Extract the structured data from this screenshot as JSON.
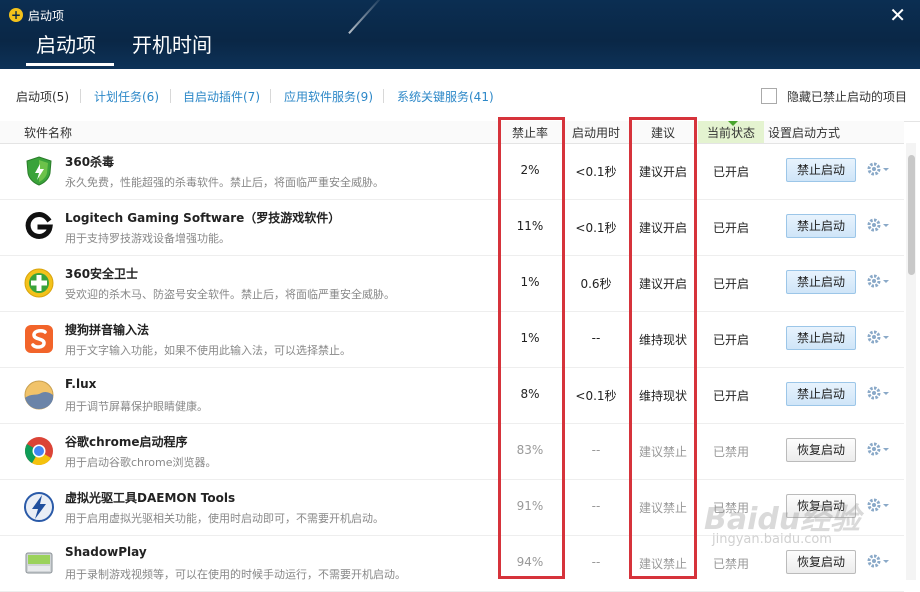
{
  "window": {
    "title": "启动项",
    "close": "✕"
  },
  "header_tabs": [
    {
      "label": "启动项"
    },
    {
      "label": "开机时间"
    }
  ],
  "subtabs": [
    {
      "label": "启动项(5)"
    },
    {
      "label": "计划任务(6)"
    },
    {
      "label": "自启动插件(7)"
    },
    {
      "label": "应用软件服务(9)"
    },
    {
      "label": "系统关键服务(41)"
    }
  ],
  "hide_disabled_label": "隐藏已禁止启动的项目",
  "columns": {
    "name": "软件名称",
    "rate": "禁止率",
    "time": "启动用时",
    "advice": "建议",
    "status": "当前状态",
    "method": "设置启动方式"
  },
  "rows": [
    {
      "icon": "shield-icon",
      "name": "360杀毒",
      "desc": "永久免费，性能超强的杀毒软件。禁止后，将面临严重安全威胁。",
      "rate": "2%",
      "time": "<0.1秒",
      "advice": "建议开启",
      "status": "已开启",
      "button": "禁止启动",
      "enabled": true
    },
    {
      "icon": "logitech-icon",
      "name": "Logitech Gaming Software（罗技游戏软件）",
      "desc": "用于支持罗技游戏设备增强功能。",
      "rate": "11%",
      "time": "<0.1秒",
      "advice": "建议开启",
      "status": "已开启",
      "button": "禁止启动",
      "enabled": true
    },
    {
      "icon": "guard-icon",
      "name": "360安全卫士",
      "desc": "受欢迎的杀木马、防盗号安全软件。禁止后，将面临严重安全威胁。",
      "rate": "1%",
      "time": "0.6秒",
      "advice": "建议开启",
      "status": "已开启",
      "button": "禁止启动",
      "enabled": true
    },
    {
      "icon": "sogou-icon",
      "name": "搜狗拼音输入法",
      "desc": "用于文字输入功能，如果不使用此输入法，可以选择禁止。",
      "rate": "1%",
      "time": "--",
      "advice": "维持现状",
      "status": "已开启",
      "button": "禁止启动",
      "enabled": true
    },
    {
      "icon": "flux-icon",
      "name": "F.lux",
      "desc": "用于调节屏幕保护眼睛健康。",
      "rate": "8%",
      "time": "<0.1秒",
      "advice": "维持现状",
      "status": "已开启",
      "button": "禁止启动",
      "enabled": true
    },
    {
      "icon": "chrome-icon",
      "name": "谷歌chrome启动程序",
      "desc": "用于启动谷歌chrome浏览器。",
      "rate": "83%",
      "time": "--",
      "advice": "建议禁止",
      "status": "已禁用",
      "button": "恢复启动",
      "enabled": false
    },
    {
      "icon": "daemon-icon",
      "name": "虚拟光驱工具DAEMON Tools",
      "desc": "用于启用虚拟光驱相关功能，使用时启动即可，不需要开机启动。",
      "rate": "91%",
      "time": "--",
      "advice": "建议禁止",
      "status": "已禁用",
      "button": "恢复启动",
      "enabled": false
    },
    {
      "icon": "shadowplay-icon",
      "name": "ShadowPlay",
      "desc": "用于录制游戏视频等，可以在使用的时候手动运行，不需要开机启动。",
      "rate": "94%",
      "time": "--",
      "advice": "建议禁止",
      "status": "已禁用",
      "button": "恢复启动",
      "enabled": false
    }
  ],
  "watermark": {
    "main": "Baidu经验",
    "sub": "jingyan.baidu.com"
  },
  "colors": {
    "header_bg": "#0a2746",
    "link": "#2d88c8",
    "highlight": "#d6333b",
    "status_head": "#e4f3d0"
  }
}
